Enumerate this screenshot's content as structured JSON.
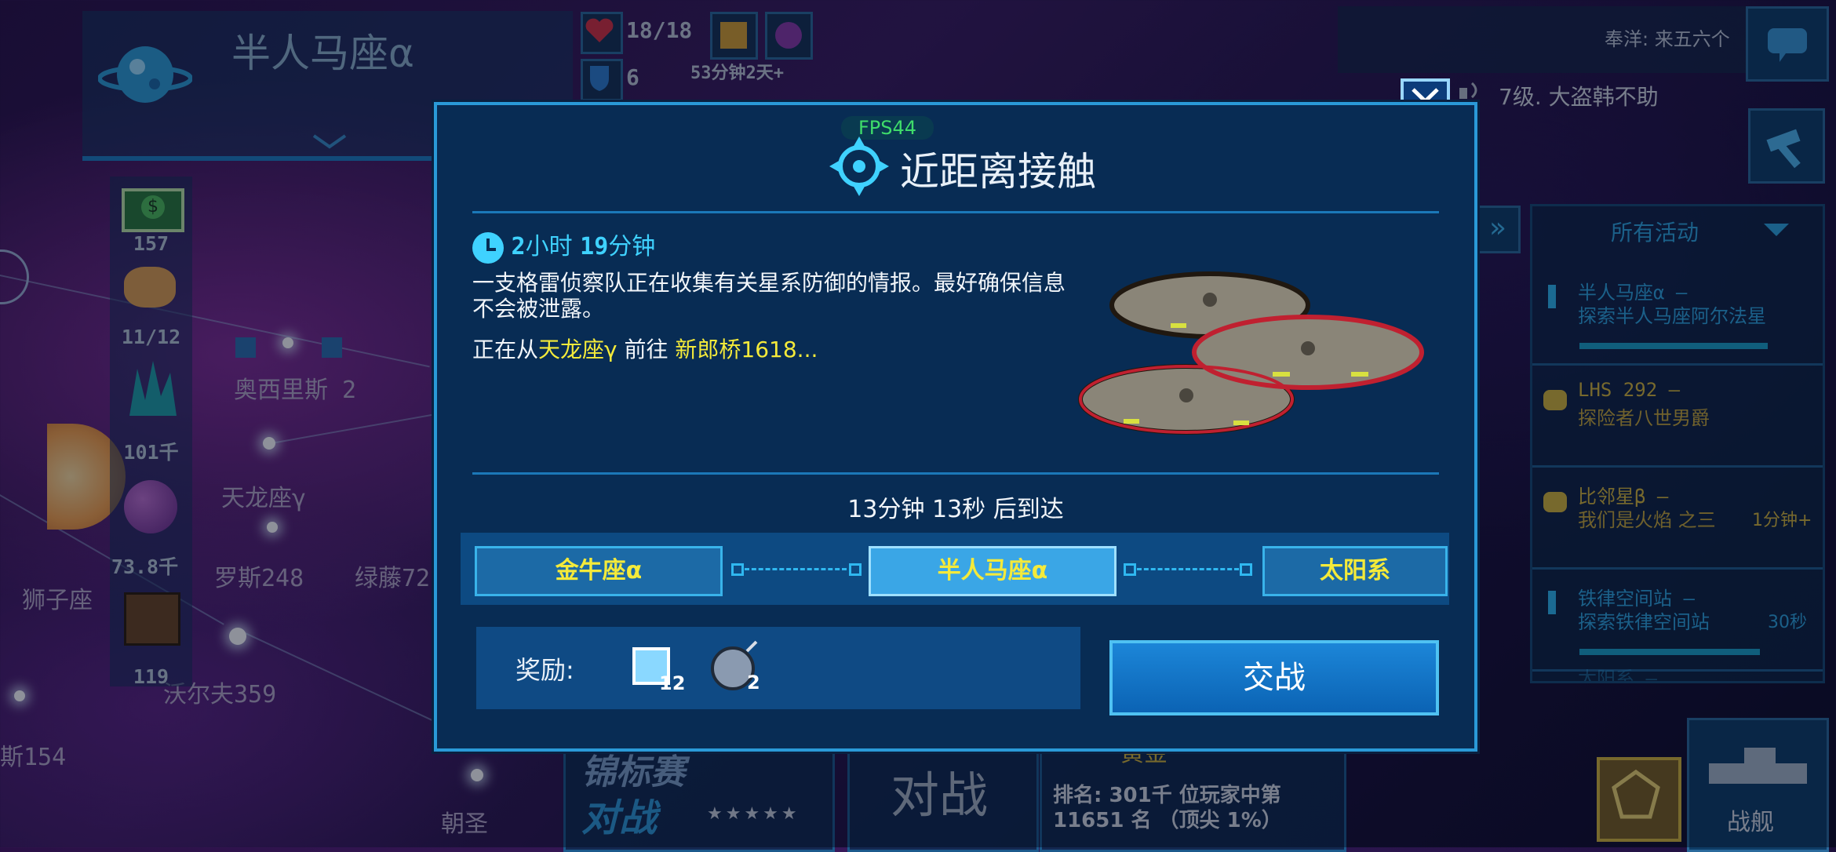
{
  "planet": {
    "name": "半人马座α"
  },
  "status": {
    "hp": "18/18",
    "shield": "6",
    "timer": "53分钟2天+"
  },
  "resources": [
    {
      "name": "money-icon",
      "value": "157"
    },
    {
      "name": "crew-icon",
      "value": "11/12"
    },
    {
      "name": "crystal-icon",
      "value": "101千"
    },
    {
      "name": "orb-icon",
      "value": "73.8千"
    },
    {
      "name": "crate-icon",
      "value": "119"
    }
  ],
  "map_labels": [
    "奥西里斯 2",
    "天龙座γ",
    "罗斯248",
    "绿藤72",
    "狮子座",
    "沃尔夫359",
    "斯154",
    "朝圣"
  ],
  "right": {
    "chat_preview": "奉洋: 来五六个",
    "notice": "7级. 大盗韩不助",
    "activity_header": "所有活动",
    "activities": [
      {
        "title": "半人马座α –",
        "sub": "探索半人马座阿尔法星",
        "extra": ""
      },
      {
        "title": "LHS 292 –",
        "sub": "探险者八世男爵",
        "extra": ""
      },
      {
        "title": "比邻星β –",
        "sub": "我们是火焰 之三",
        "extra": "1分钟+"
      },
      {
        "title": "铁律空间站 –",
        "sub": "探索铁律空间站",
        "extra": "30秒"
      },
      {
        "title": "太阳系 –",
        "sub": "",
        "extra": ""
      }
    ]
  },
  "bottom": {
    "tournament_title": "锦标赛",
    "tournament_sub": "对战",
    "stars": "★★★★★",
    "battle": "对战",
    "league": "黄金",
    "rank_line1": "排名: 301千 位玩家中第",
    "rank_line2": "11651 名 （顶尖 1%）",
    "fleet_label": "战舰"
  },
  "modal": {
    "fps": "FPS44",
    "title": "近距离接触",
    "time_hours": "2",
    "time_hours_unit": "小时",
    "time_minutes": "19",
    "time_minutes_unit": "分钟",
    "description": "一支格雷侦察队正在收集有关星系防御的情报。最好确保信息不会被泄露。",
    "route_prefix": "正在从",
    "route_from": "天龙座γ",
    "route_mid": "前往",
    "route_to": "新郎桥1618...",
    "arrival": "13分钟 13秒 后到达",
    "nodes": [
      "金牛座α",
      "半人马座α",
      "太阳系"
    ],
    "reward_label": "奖励:",
    "reward_counts": [
      "12",
      "2"
    ],
    "fight_button": "交战"
  },
  "colors": {
    "accent": "#2a9ad8",
    "highlight": "#f4ea3a",
    "time": "#3fd2ff"
  }
}
